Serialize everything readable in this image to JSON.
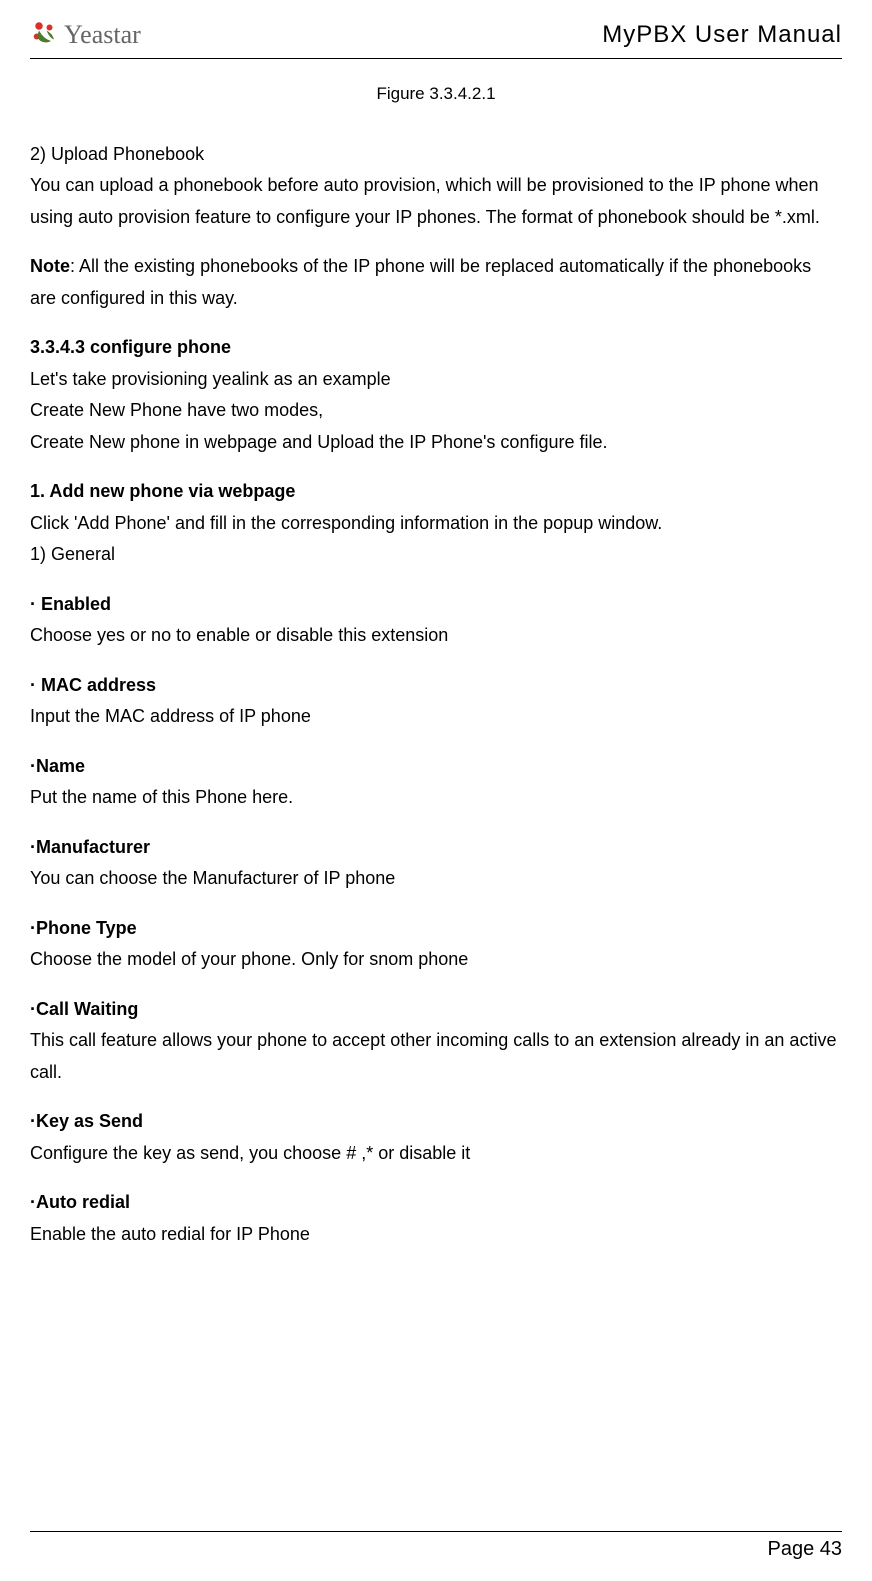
{
  "header": {
    "brand": "Yeastar",
    "title": "MyPBX User Manual"
  },
  "figure_caption": "Figure 3.3.4.2.1",
  "section_upload": {
    "title": "2)  Upload Phonebook",
    "p1": "You can upload a phonebook before auto provision, which will be provisioned to the IP phone when using auto provision feature to configure your IP phones. The format of phonebook should be *.xml.",
    "note_label": "Note",
    "note_body": ": All the existing phonebooks of the IP phone will be replaced automatically if the phonebooks are configured in this way."
  },
  "section_configure": {
    "heading": "3.3.4.3    configure phone",
    "line1": "Let's take provisioning yealink as an example",
    "line2": "Create New Phone have two modes,",
    "line3": "Create New phone in webpage and Upload the IP Phone's configure file."
  },
  "section_addnew": {
    "heading": "1. Add new phone via webpage",
    "line1": "Click 'Add Phone' and fill in the corresponding information in the popup window.",
    "line2": "1)  General"
  },
  "fields": [
    {
      "label": "· Enabled",
      "desc": "Choose yes or no to enable or disable this extension"
    },
    {
      "label": "· MAC address",
      "desc": "Input the MAC address of IP phone"
    },
    {
      "label": "·Name",
      "desc": "Put the name of this Phone here."
    },
    {
      "label": "·Manufacturer",
      "desc": "You can choose the Manufacturer of IP phone"
    },
    {
      "label": "·Phone Type",
      "desc": "Choose the model of your phone. Only for snom phone"
    },
    {
      "label": "·Call Waiting",
      "desc": "This call feature allows your phone to accept other incoming calls to an extension already in an active call."
    },
    {
      "label": "·Key as Send",
      "desc": "Configure the key as send, you choose # ,* or disable it"
    },
    {
      "label": "·Auto redial",
      "desc": "Enable the auto redial for IP Phone"
    }
  ],
  "footer": {
    "page": "Page 43"
  }
}
